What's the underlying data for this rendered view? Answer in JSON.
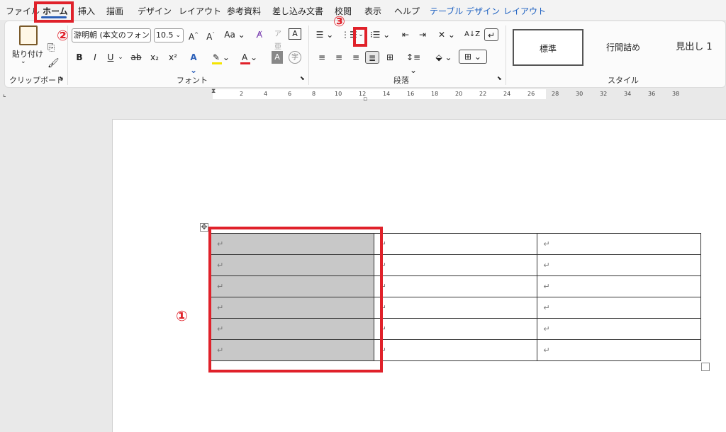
{
  "menu": {
    "tabs": [
      "ファイル",
      "ホーム",
      "挿入",
      "描画",
      "デザイン",
      "レイアウト",
      "参考資料",
      "差し込み文書",
      "校閲",
      "表示",
      "ヘルプ",
      "テーブル デザイン",
      "レイアウト"
    ]
  },
  "clipboard": {
    "paste_label": "貼り付け",
    "group_label": "クリップボード"
  },
  "font": {
    "name": "游明朝 (本文のフォン",
    "size": "10.5",
    "aa_label": "Aa",
    "bold": "B",
    "italic": "I",
    "underline": "U",
    "strike": "ab",
    "subscript": "x₂",
    "superscript": "x²",
    "group_label": "フォント"
  },
  "paragraph": {
    "group_label": "段落"
  },
  "styles": {
    "items": [
      "標準",
      "行間詰め",
      "見出し 1"
    ],
    "group_label": "スタイル"
  },
  "ruler": {
    "ticks": [
      "2",
      "4",
      "6",
      "8",
      "10",
      "12",
      "14",
      "16",
      "18",
      "20",
      "22",
      "24",
      "26",
      "28",
      "30",
      "32",
      "34",
      "36",
      "38"
    ]
  },
  "table": {
    "rows": 6,
    "cols": 3,
    "cell_mark": "↵"
  },
  "annotations": {
    "one": "①",
    "two": "②",
    "three": "③"
  },
  "colors": {
    "accent": "#2b5fb8",
    "annotation": "#e0212a",
    "selection": "#c8c8c8"
  }
}
